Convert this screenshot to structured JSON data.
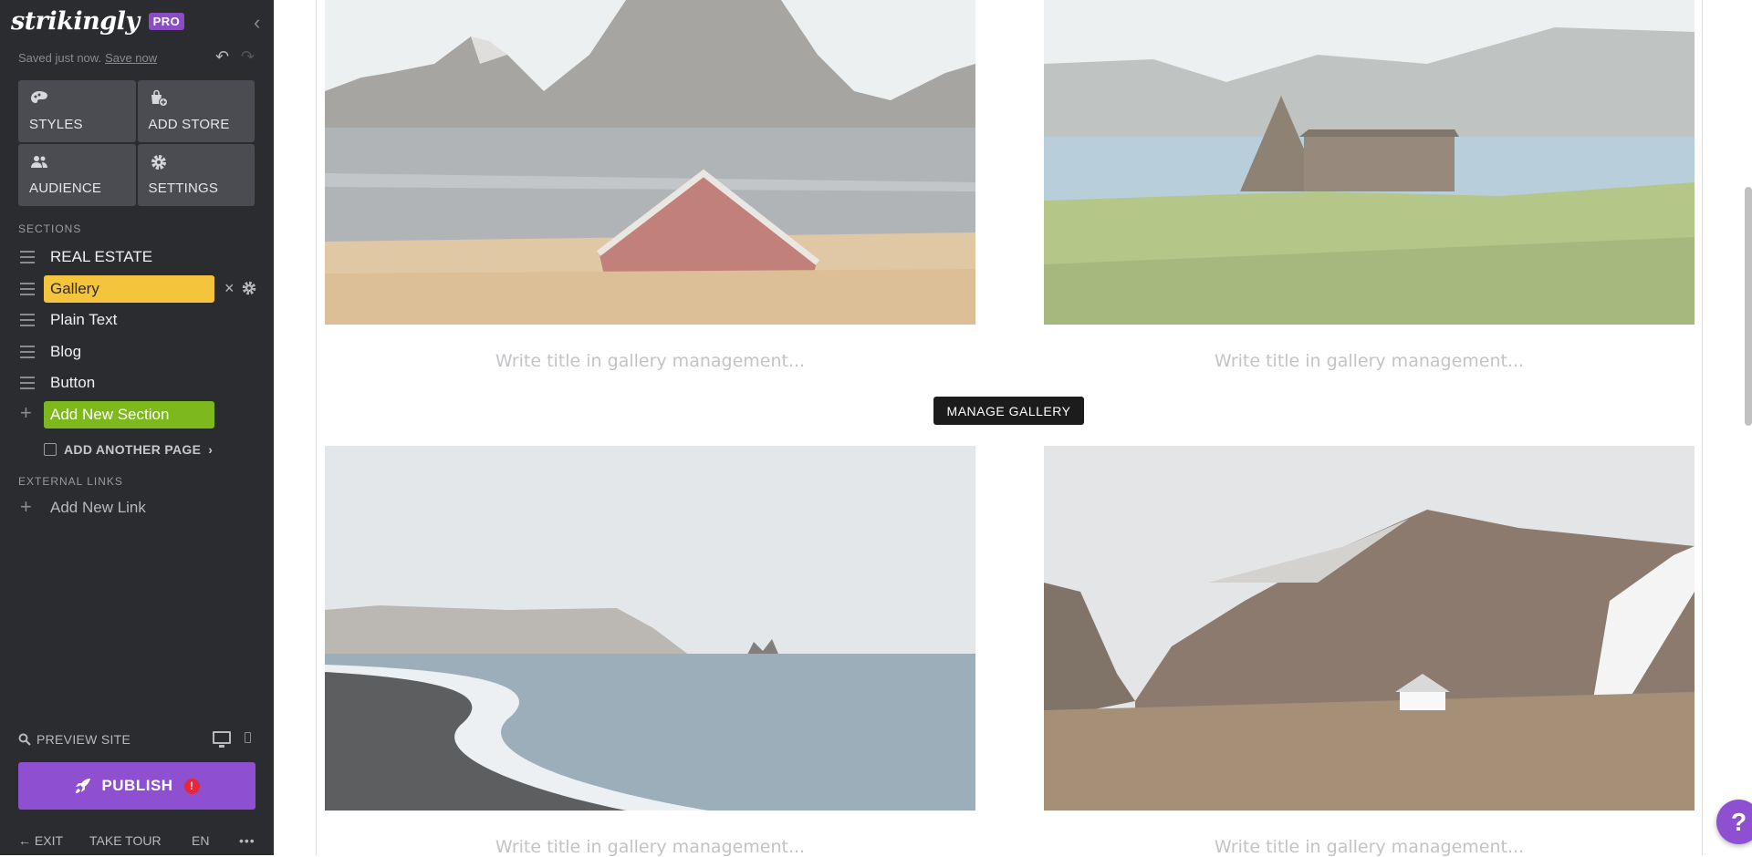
{
  "brand": {
    "logo": "strikingly",
    "badge": "PRO"
  },
  "save_status": {
    "text": "Saved just now.",
    "link": "Save now"
  },
  "tiles": [
    {
      "label": "STYLES",
      "icon": "palette-icon"
    },
    {
      "label": "ADD STORE",
      "icon": "store-icon"
    },
    {
      "label": "AUDIENCE",
      "icon": "people-icon"
    },
    {
      "label": "SETTINGS",
      "icon": "gear-icon"
    }
  ],
  "sections": {
    "heading": "SECTIONS",
    "items": [
      {
        "label": "REAL ESTATE"
      },
      {
        "label": "Gallery",
        "selected": true
      },
      {
        "label": "Plain Text"
      },
      {
        "label": "Blog"
      },
      {
        "label": "Button"
      }
    ],
    "add_label": "Add New Section",
    "another_page": "ADD ANOTHER PAGE"
  },
  "external_links": {
    "heading": "EXTERNAL LINKS",
    "add_label": "Add New Link"
  },
  "preview": {
    "label": "PREVIEW SITE"
  },
  "publish": {
    "label": "PUBLISH",
    "alert": "!"
  },
  "footer": {
    "exit": "EXIT",
    "tour": "TAKE TOUR",
    "lang": "EN",
    "more": "•••"
  },
  "gallery": {
    "manage_label": "MANAGE GALLERY",
    "captions": [
      "Write title in gallery management...",
      "Write title in gallery management...",
      "Write title in gallery management...",
      "Write title in gallery management..."
    ]
  },
  "help": {
    "label": "?"
  },
  "colors": {
    "sidebar": "#2b2c2f",
    "tile": "#4a4c52",
    "selected": "#f4c53c",
    "add": "#7db81d",
    "publish": "#8e4fd1"
  }
}
